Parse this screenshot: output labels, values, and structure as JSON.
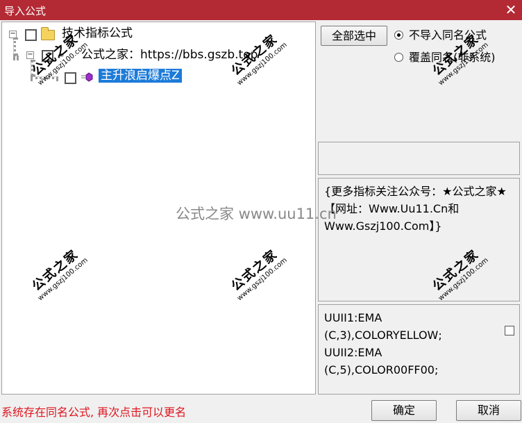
{
  "window": {
    "title": "导入公式",
    "close_glyph": "✕"
  },
  "tree": {
    "root": {
      "expander": "−",
      "label": "技术指标公式",
      "icon": "folder-icon"
    },
    "source": {
      "expander": "−",
      "label": "公式之家：https://bbs.gszb.top",
      "icon": "link-icon"
    },
    "formula": {
      "label": "主升浪启爆点Z",
      "icon": "formula-icon"
    }
  },
  "options": {
    "select_all_label": "全部选中",
    "radio_skip_label": "不导入同名公式",
    "radio_overwrite_label": "覆盖同名(非系统)",
    "selected": "skip"
  },
  "description": {
    "text": "{更多指标关注公众号：★公式之家★ 【网址：Www.Uu11.Cn和Www.Gszj100.Com】}"
  },
  "code": {
    "lines": [
      "UUII1:EMA",
      "(C,3),COLORYELLOW;",
      "UUII2:EMA",
      "(C,5),COLOR00FF00;"
    ]
  },
  "status": {
    "message": "系统存在同名公式, 再次点击可以更名"
  },
  "footer": {
    "ok_label": "确定",
    "cancel_label": "取消"
  },
  "watermark": {
    "stamp": "公式之家",
    "url": "www.gszj100.com",
    "center": "公式之家 www.uu11.cn"
  },
  "colors": {
    "title_bar": "#b32a34",
    "selection": "#1c7bd9",
    "status_text": "#e0141e"
  }
}
